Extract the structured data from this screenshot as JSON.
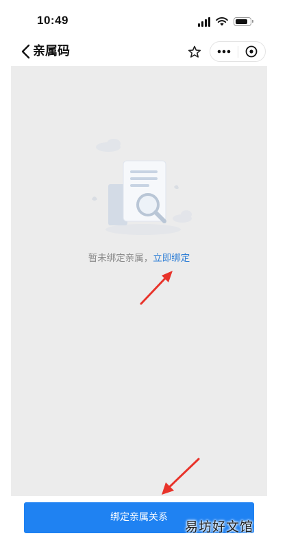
{
  "status_bar": {
    "time": "10:49",
    "icons": [
      "signal-icon",
      "wifi-icon",
      "battery-icon"
    ]
  },
  "nav": {
    "title": "亲属码",
    "icons": [
      "back-chevron-icon",
      "star-icon",
      "more-dots-icon",
      "close-circle-icon"
    ]
  },
  "empty_state": {
    "message": "暂未绑定亲属，",
    "link": "立即绑定",
    "illustration": "document-search-icon"
  },
  "bottom": {
    "bind_button": "绑定亲属关系"
  },
  "watermark": "易坊好文馆",
  "colors": {
    "accent": "#1f82f2",
    "link": "#2f7fd6",
    "content_bg": "#ececec",
    "arrow": "#e8332a"
  }
}
